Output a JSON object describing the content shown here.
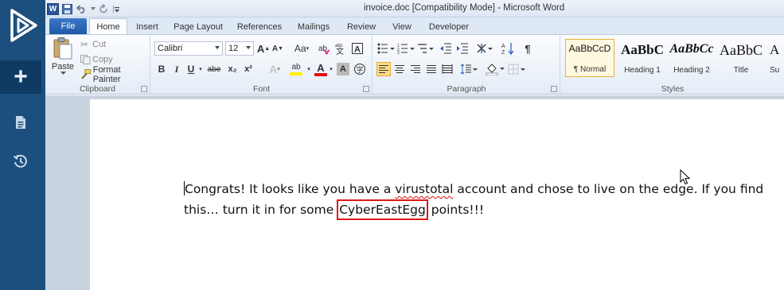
{
  "window": {
    "title": "invoice.doc [Compatibility Mode] - Microsoft Word",
    "app_icon_letter": "W"
  },
  "colors": {
    "rail": "#1c4f7e",
    "rail_active": "#0f3a63",
    "file_tab": "#2a64b4",
    "highlight_box": "#e01818",
    "spellcheck": "#d01010"
  },
  "rail": {
    "add_label": "+",
    "icons": [
      "play-logo-icon",
      "plus-icon",
      "document-icon",
      "history-icon"
    ]
  },
  "tabs": [
    {
      "label": "File"
    },
    {
      "label": "Home"
    },
    {
      "label": "Insert"
    },
    {
      "label": "Page Layout"
    },
    {
      "label": "References"
    },
    {
      "label": "Mailings"
    },
    {
      "label": "Review"
    },
    {
      "label": "View"
    },
    {
      "label": "Developer"
    }
  ],
  "clipboard": {
    "label": "Clipboard",
    "paste": "Paste",
    "cut": "Cut",
    "copy": "Copy",
    "format_painter": "Format Painter"
  },
  "font": {
    "label": "Font",
    "family": "Calibri",
    "size": "12",
    "change_case": "Aa",
    "bold": "B",
    "italic": "I",
    "underline": "U",
    "strike": "abe",
    "subscript": "x₂",
    "superscript": "x²",
    "grow": "A",
    "shrink": "A",
    "clear": "A",
    "text_effects": "A",
    "highlight": "ab",
    "font_color": "A",
    "shading": "A"
  },
  "paragraph": {
    "label": "Paragraph",
    "sort": "A↓Z",
    "pilcrow": "¶"
  },
  "styles": {
    "label": "Styles",
    "items": [
      {
        "sample": "AaBbCcD",
        "name": "¶ Normal"
      },
      {
        "sample": "AaBbC",
        "name": "Heading 1"
      },
      {
        "sample": "AaBbCc",
        "name": "Heading 2"
      },
      {
        "sample": "AaBbC",
        "name": "Title"
      },
      {
        "sample": "A",
        "name": "Su"
      }
    ]
  },
  "document": {
    "text_part1": "Congrats! It looks like you have a ",
    "misspelled": "virustotal",
    "text_part2": " account and chose to live on the edge. If you find this… turn it in for some ",
    "highlighted": "CyberEastEgg",
    "text_part3": " points!!!"
  }
}
